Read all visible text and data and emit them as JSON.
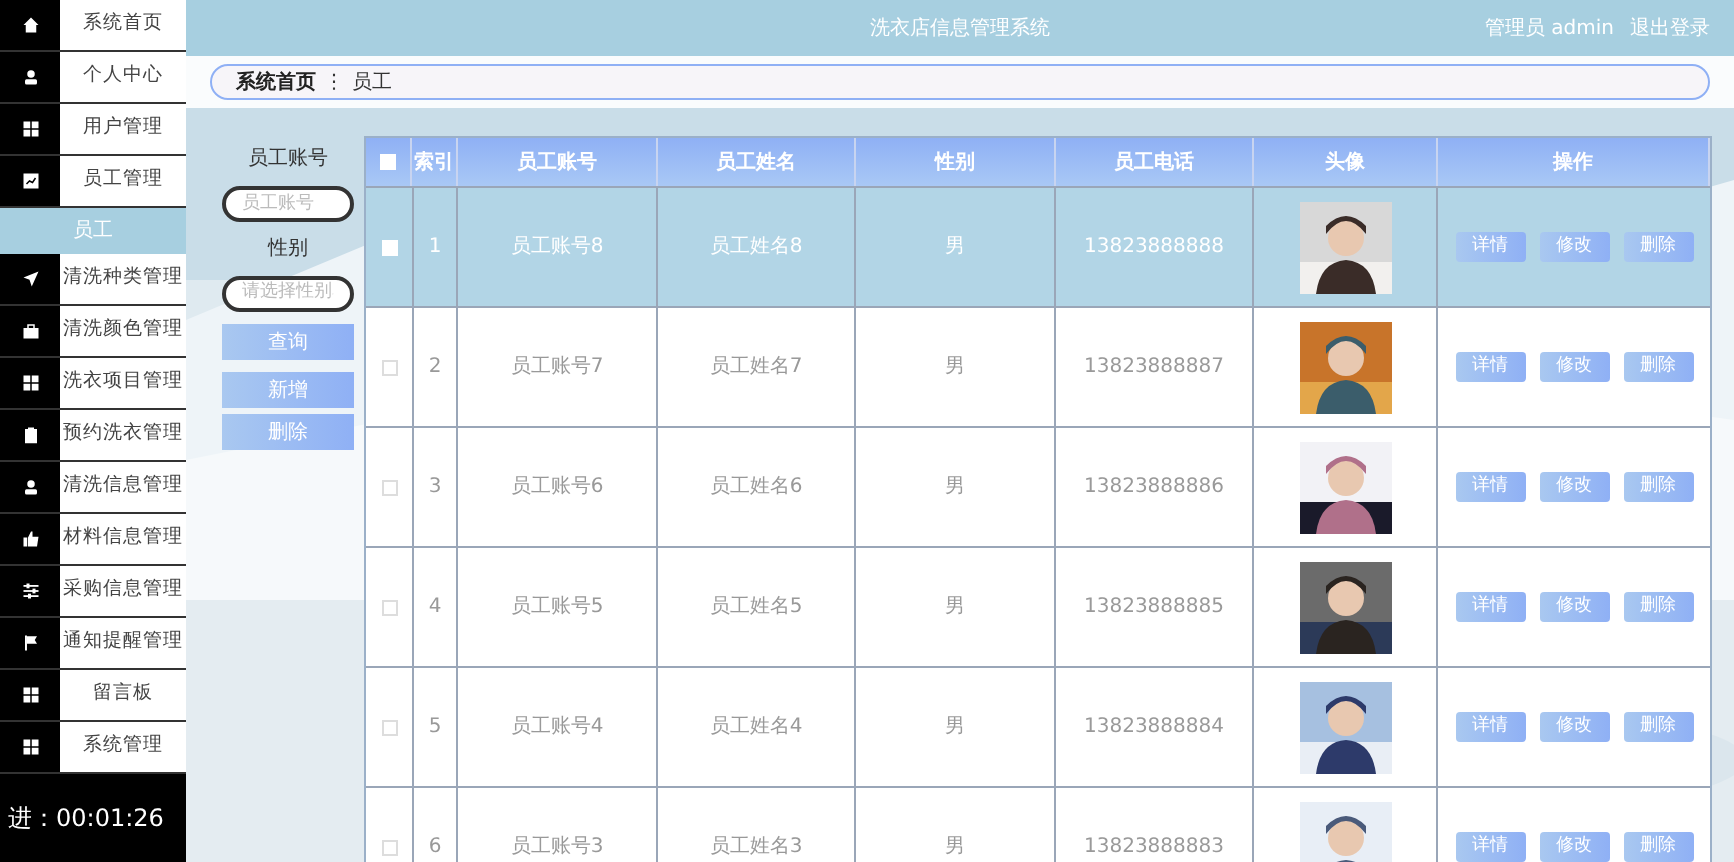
{
  "header": {
    "title": "洗衣店信息管理系统",
    "user": "管理员 admin",
    "logout": "退出登录"
  },
  "sidebar": {
    "items": [
      {
        "label": "系统首页"
      },
      {
        "label": "个人中心"
      },
      {
        "label": "用户管理"
      },
      {
        "label": "员工管理",
        "expanded": true,
        "children": [
          {
            "label": "员工",
            "selected": true
          }
        ]
      },
      {
        "label": "清洗种类管理"
      },
      {
        "label": "清洗颜色管理"
      },
      {
        "label": "洗衣项目管理"
      },
      {
        "label": "预约洗衣管理"
      },
      {
        "label": "清洗信息管理"
      },
      {
        "label": "材料信息管理"
      },
      {
        "label": "采购信息管理"
      },
      {
        "label": "通知提醒管理"
      },
      {
        "label": "留言板"
      },
      {
        "label": "系统管理"
      }
    ]
  },
  "breadcrumb": [
    "系统首页",
    "⋮",
    "员工"
  ],
  "search": {
    "account_label": "员工账号",
    "account_placeholder": "员工账号",
    "gender_label": "性别",
    "gender_placeholder": "请选择性别",
    "buttons": [
      "查询",
      "新增",
      "删除"
    ]
  },
  "table": {
    "select_all": {
      "checked": false
    },
    "columns": [
      "索引",
      "员工账号",
      "员工姓名",
      "性别",
      "员工电话",
      "头像",
      "操作"
    ],
    "rows": [
      {
        "index": "1",
        "account": "员工账号8",
        "name": "员工姓名8",
        "gender": "男",
        "phone": "13823888888",
        "selected": true,
        "actions": [
          "详情",
          "修改",
          "删除"
        ]
      },
      {
        "index": "2",
        "account": "员工账号7",
        "name": "员工姓名7",
        "gender": "男",
        "phone": "13823888887",
        "selected": false,
        "actions": [
          "详情",
          "修改",
          "删除"
        ]
      },
      {
        "index": "3",
        "account": "员工账号6",
        "name": "员工姓名6",
        "gender": "男",
        "phone": "13823888886",
        "selected": false,
        "actions": [
          "详情",
          "修改",
          "删除"
        ]
      },
      {
        "index": "4",
        "account": "员工账号5",
        "name": "员工姓名5",
        "gender": "男",
        "phone": "13823888885",
        "selected": false,
        "actions": [
          "详情",
          "修改",
          "删除"
        ]
      },
      {
        "index": "5",
        "account": "员工账号4",
        "name": "员工姓名4",
        "gender": "男",
        "phone": "13823888884",
        "selected": false,
        "actions": [
          "详情",
          "修改",
          "删除"
        ]
      },
      {
        "index": "6",
        "account": "员工账号3",
        "name": "员工姓名3",
        "gender": "男",
        "phone": "13823888883",
        "selected": false,
        "actions": [
          "详情",
          "修改",
          "删除"
        ]
      }
    ]
  },
  "video_overlay": {
    "time": "进：00:01:26"
  }
}
